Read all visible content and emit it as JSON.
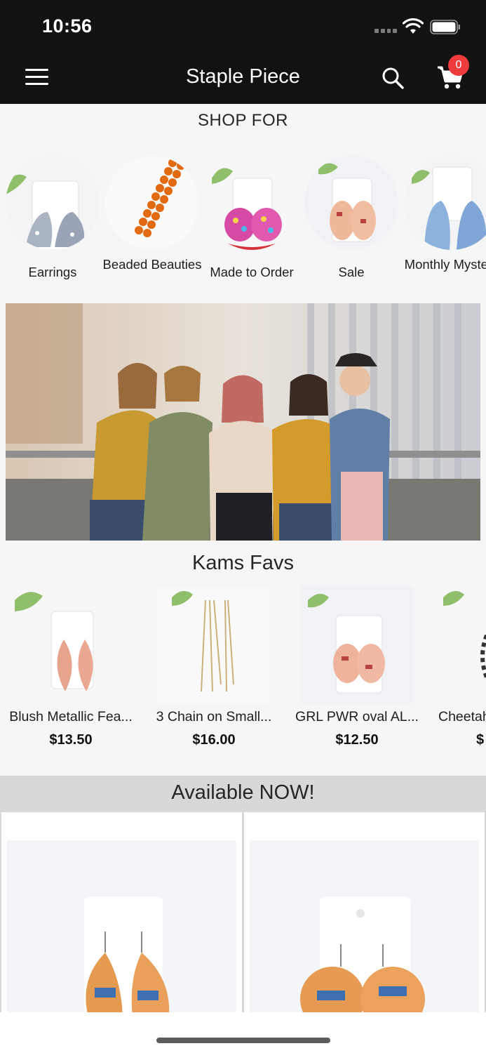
{
  "status_bar": {
    "time": "10:56"
  },
  "header": {
    "title": "Staple Piece",
    "cart_count": "0"
  },
  "shop_for": {
    "heading": "SHOP FOR",
    "categories": [
      {
        "label": "Earrings"
      },
      {
        "label": "Beaded Beauties"
      },
      {
        "label": "Made to Order"
      },
      {
        "label": "Sale"
      },
      {
        "label": "Monthly Mystery"
      }
    ]
  },
  "favs": {
    "heading": "Kams Favs",
    "products": [
      {
        "name": "Blush Metallic Fea...",
        "price": "$13.50"
      },
      {
        "name": "3 Chain on Small...",
        "price": "$16.00"
      },
      {
        "name": "GRL PWR oval AL...",
        "price": "$12.50"
      },
      {
        "name": "Cheetah",
        "price": "$"
      }
    ]
  },
  "available": {
    "heading": "Available NOW!"
  },
  "colors": {
    "header_bg": "#121212",
    "badge": "#ee3b3b",
    "section_bar": "#d8d8d8"
  }
}
